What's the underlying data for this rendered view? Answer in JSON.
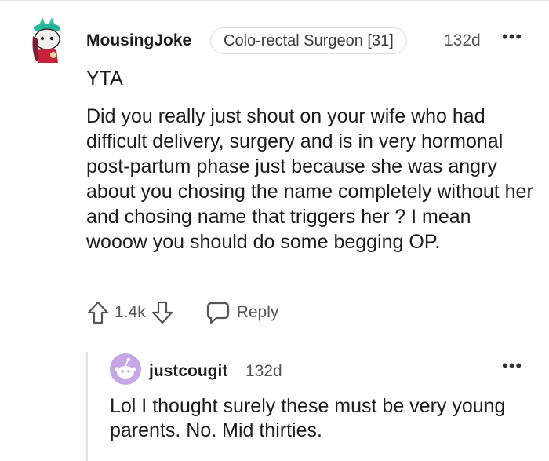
{
  "comment": {
    "username": "MousingJoke",
    "flair": "Colo-rectal Surgeon [31]",
    "age": "132d",
    "more": "•••",
    "paragraph_1": "YTA",
    "paragraph_2": "Did you really just shout on your wife who had difficult delivery, surgery and is in very hormonal post-partum phase just because she was angry about you chosing the name completely without her and chosing name that triggers her ? I mean wooow you should do some begging OP.",
    "votes": "1.4k",
    "reply_label": "Reply",
    "avatar_icon": "snoo-avatar-icon"
  },
  "reply": {
    "username": "justcougit",
    "age": "132d",
    "more": "•••",
    "text": "Lol I thought surely these must be very young parents. No. Mid thirties.",
    "avatar_icon": "snoo-avatar-icon"
  },
  "colors": {
    "text": "#1c1c1c",
    "meta": "#555555",
    "border": "#dcdcdc",
    "avatar_purple": "#c6a6e6"
  }
}
